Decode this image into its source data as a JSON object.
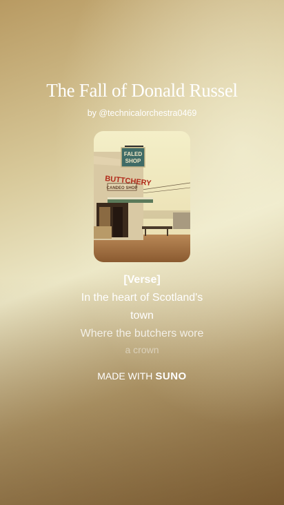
{
  "song": {
    "title": "The Fall of Donald Russel",
    "byline": "by @technicalorchestra0469"
  },
  "cover": {
    "sign_top": "FALED",
    "sign_bottom": "SHOP",
    "shop_name": "BUTTCHERY",
    "shop_sub": "CANDEO SHOP"
  },
  "lyrics": {
    "heading": "[Verse]",
    "lines": [
      "In the heart of Scotland's",
      "town",
      "Where the butchers wore",
      "a crown"
    ]
  },
  "footer": {
    "made_with": "MADE WITH",
    "brand": "SUNO"
  }
}
